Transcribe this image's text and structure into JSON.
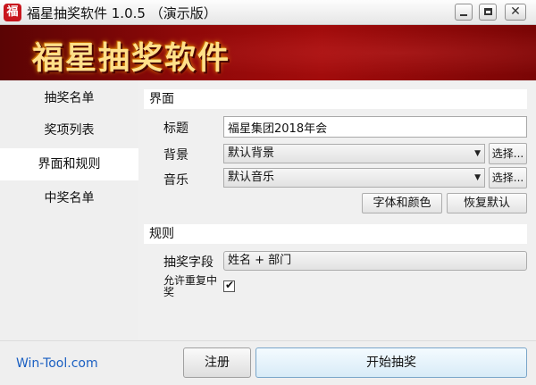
{
  "window": {
    "title": "福星抽奖软件 1.0.5 （演示版）",
    "app_icon_glyph": "福",
    "minimize_glyph": "",
    "close_glyph": "✕"
  },
  "banner": {
    "title": "福星抽奖软件"
  },
  "sidebar": {
    "items": [
      {
        "label": "抽奖名单",
        "active": false
      },
      {
        "label": "奖项列表",
        "active": false
      },
      {
        "label": "界面和规则",
        "active": true
      },
      {
        "label": "中奖名单",
        "active": false
      }
    ]
  },
  "interface_section": {
    "heading": "界面",
    "title_label": "标题",
    "title_value": "福星集团2018年会",
    "background_label": "背景",
    "background_value": "默认背景",
    "background_browse": "选择...",
    "music_label": "音乐",
    "music_value": "默认音乐",
    "music_browse": "选择...",
    "font_color_button": "字体和颜色",
    "restore_default_button": "恢复默认"
  },
  "rules_section": {
    "heading": "规则",
    "field_label": "抽奖字段",
    "field_value": "姓名 + 部门",
    "allow_repeat_label": "允许重复中奖",
    "allow_repeat_checked": true
  },
  "bottom": {
    "site_link": "Win-Tool.com",
    "register_button": "注册",
    "start_button": "开始抽奖"
  },
  "colors": {
    "banner_red": "#8f0808",
    "banner_text": "#ffe08a",
    "link_blue": "#1a5fc2"
  }
}
